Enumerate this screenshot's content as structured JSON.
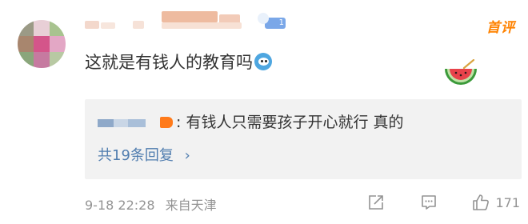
{
  "comment": {
    "first_tag": "首评",
    "text": "这就是有钱人的教育吗",
    "level_badge": "1",
    "colors": {
      "accent_orange": "#ff8200",
      "link_blue": "#507daf",
      "meta_gray": "#939393"
    }
  },
  "reply_preview": {
    "separator": ":",
    "text": "有钱人只需要孩子开心就行 真的",
    "count_label": "共19条回复",
    "chevron": "›"
  },
  "footer": {
    "date": "9-18 22:28",
    "source": "来自天津",
    "like_count": "171",
    "icons": [
      "share-icon",
      "comment-icon",
      "like-icon"
    ]
  }
}
